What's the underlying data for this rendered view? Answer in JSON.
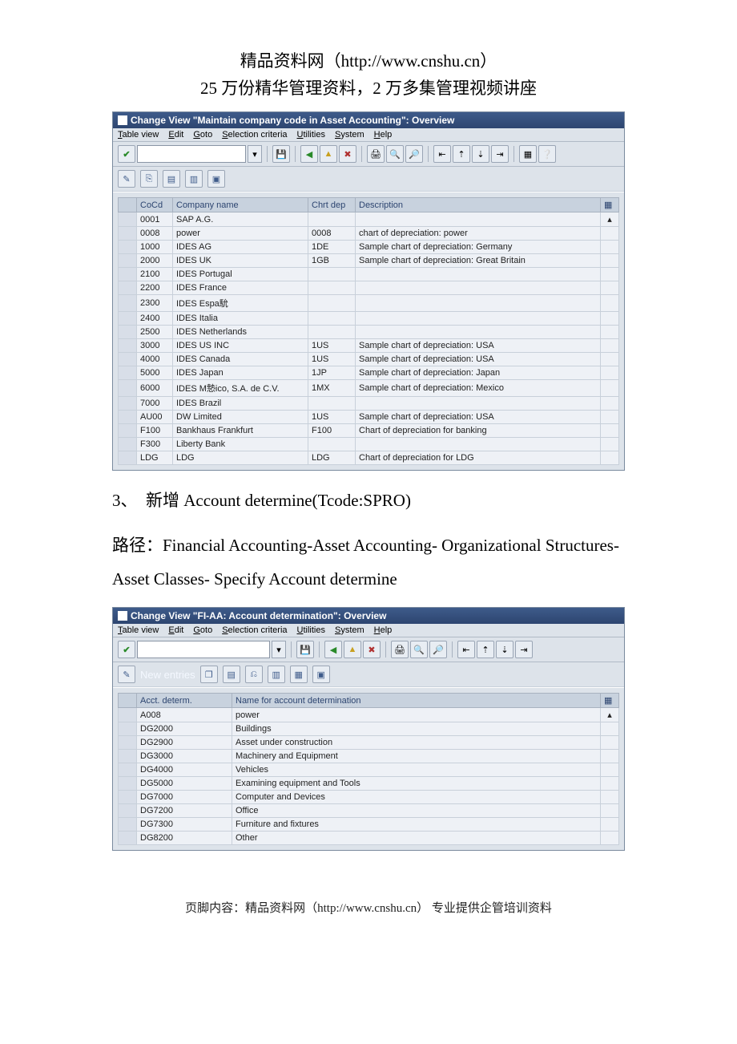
{
  "header": {
    "line1": "精品资料网（http://www.cnshu.cn）",
    "line2": "25 万份精华管理资料，2 万多集管理视频讲座"
  },
  "win1": {
    "title": "Change View \"Maintain company code in Asset Accounting\": Overview",
    "menu": [
      "Table view",
      "Edit",
      "Goto",
      "Selection criteria",
      "Utilities",
      "System",
      "Help"
    ],
    "cols": [
      "CoCd",
      "Company name",
      "Chrt dep",
      "Description"
    ],
    "rows": [
      [
        "0001",
        "SAP A.G.",
        "",
        ""
      ],
      [
        "0008",
        "power",
        "0008",
        "chart of depreciation: power"
      ],
      [
        "1000",
        "IDES AG",
        "1DE",
        "Sample chart of depreciation: Germany"
      ],
      [
        "2000",
        "IDES UK",
        "1GB",
        "Sample chart of depreciation: Great Britain"
      ],
      [
        "2100",
        "IDES Portugal",
        "",
        ""
      ],
      [
        "2200",
        "IDES France",
        "",
        ""
      ],
      [
        "2300",
        "IDES Espa馻",
        "",
        ""
      ],
      [
        "2400",
        "IDES Italia",
        "",
        ""
      ],
      [
        "2500",
        "IDES Netherlands",
        "",
        ""
      ],
      [
        "3000",
        "IDES US INC",
        "1US",
        "Sample chart of depreciation: USA"
      ],
      [
        "4000",
        "IDES Canada",
        "1US",
        "Sample chart of depreciation: USA"
      ],
      [
        "5000",
        "IDES Japan",
        "1JP",
        "Sample chart of depreciation: Japan"
      ],
      [
        "6000",
        "IDES M慹ico, S.A. de C.V.",
        "1MX",
        "Sample chart of depreciation: Mexico"
      ],
      [
        "7000",
        "IDES Brazil",
        "",
        ""
      ],
      [
        "AU00",
        "DW Limited",
        "1US",
        "Sample chart of depreciation: USA"
      ],
      [
        "F100",
        "Bankhaus Frankfurt",
        "F100",
        "Chart of depreciation for banking"
      ],
      [
        "F300",
        "Liberty Bank",
        "",
        ""
      ],
      [
        "LDG",
        "LDG",
        "LDG",
        "Chart of depreciation for LDG"
      ]
    ]
  },
  "step3": {
    "heading": "3、　新增 Account determine(Tcode:SPRO)",
    "path": "路径：Financial Accounting-Asset Accounting- Organizational Structures- Asset Classes- Specify Account determine"
  },
  "win2": {
    "title": "Change View \"FI-AA: Account determination\": Overview",
    "menu": [
      "Table view",
      "Edit",
      "Goto",
      "Selection criteria",
      "Utilities",
      "System",
      "Help"
    ],
    "newentries": "New entries",
    "cols": [
      "Acct. determ.",
      "Name for account determination"
    ],
    "rows": [
      [
        "A008",
        "power"
      ],
      [
        "DG2000",
        "Buildings"
      ],
      [
        "DG2900",
        "Asset under construction"
      ],
      [
        "DG3000",
        "Machinery and Equipment"
      ],
      [
        "DG4000",
        "Vehicles"
      ],
      [
        "DG5000",
        "Examining equipment and Tools"
      ],
      [
        "DG7000",
        "Computer and Devices"
      ],
      [
        "DG7200",
        "Office"
      ],
      [
        "DG7300",
        "Furniture and fixtures"
      ],
      [
        "DG8200",
        "Other"
      ]
    ]
  },
  "footer": "页脚内容：精品资料网（http://www.cnshu.cn）  专业提供企管培训资料"
}
